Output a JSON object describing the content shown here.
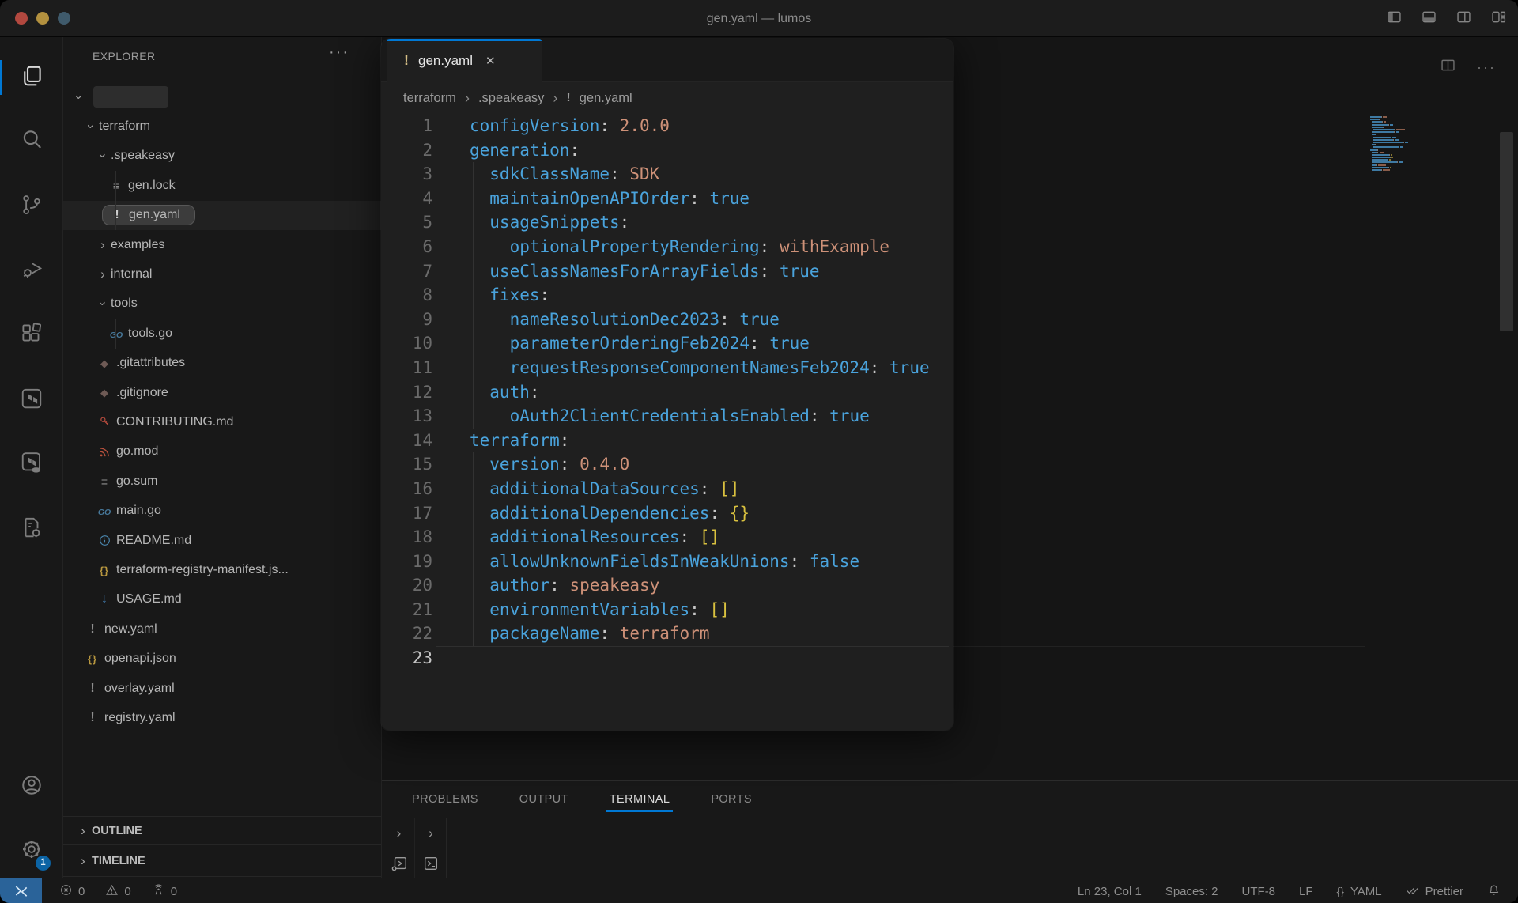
{
  "window": {
    "title": "gen.yaml — lumos"
  },
  "colors": {
    "accent": "#0078d4",
    "token_key": "#4aa3dc",
    "token_string": "#ce9178",
    "token_bracket": "#d9c13f",
    "token_punct": "#c8c8c8",
    "traffic_red": "#b2483f",
    "traffic_yellow": "#b3913f",
    "traffic_green_dim": "#3f5a6b",
    "remote_bg": "#2a6399"
  },
  "titlebar_icons": [
    "toggle-sidebar-icon",
    "toggle-panel-icon",
    "toggle-secondary-sidebar-icon",
    "customize-layout-icon"
  ],
  "activity_bar": {
    "items": [
      {
        "name": "explorer",
        "icon": "files-icon",
        "active": true
      },
      {
        "name": "search",
        "icon": "search-icon",
        "active": false
      },
      {
        "name": "source-control",
        "icon": "git-branch-icon",
        "active": false
      },
      {
        "name": "run-debug",
        "icon": "debug-icon",
        "active": false
      },
      {
        "name": "extensions",
        "icon": "extensions-icon",
        "active": false
      },
      {
        "name": "terraform",
        "icon": "terraform-icon",
        "active": false
      },
      {
        "name": "terraform-cloud",
        "icon": "terraform-cloud-icon",
        "active": false
      },
      {
        "name": "file-tools",
        "icon": "file-gear-icon",
        "active": false
      }
    ],
    "bottom": {
      "account": "account-icon",
      "settings": "gear-icon",
      "settings_badge": "1"
    }
  },
  "sidebar": {
    "header": "EXPLORER",
    "more_label": "···",
    "tree": [
      {
        "label": "",
        "level": 0,
        "kind": "workspace-redacted",
        "expanded": true
      },
      {
        "label": "terraform",
        "level": 1,
        "kind": "folder",
        "expanded": true
      },
      {
        "label": ".speakeasy",
        "level": 2,
        "kind": "folder",
        "expanded": true
      },
      {
        "label": "gen.lock",
        "level": 3,
        "kind": "file",
        "icon": "list"
      },
      {
        "label": "gen.yaml",
        "level": 3,
        "kind": "file",
        "icon": "warn-bright",
        "selected": true
      },
      {
        "label": "examples",
        "level": 2,
        "kind": "folder",
        "expanded": false
      },
      {
        "label": "internal",
        "level": 2,
        "kind": "folder",
        "expanded": false
      },
      {
        "label": "tools",
        "level": 2,
        "kind": "folder",
        "expanded": true
      },
      {
        "label": "tools.go",
        "level": 3,
        "kind": "file",
        "icon": "go"
      },
      {
        "label": ".gitattributes",
        "level": 2,
        "kind": "file",
        "icon": "git"
      },
      {
        "label": ".gitignore",
        "level": 2,
        "kind": "file",
        "icon": "git"
      },
      {
        "label": "CONTRIBUTING.md",
        "level": 2,
        "kind": "file",
        "icon": "key"
      },
      {
        "label": "go.mod",
        "level": 2,
        "kind": "file",
        "icon": "rss"
      },
      {
        "label": "go.sum",
        "level": 2,
        "kind": "file",
        "icon": "list"
      },
      {
        "label": "main.go",
        "level": 2,
        "kind": "file",
        "icon": "go"
      },
      {
        "label": "README.md",
        "level": 2,
        "kind": "file",
        "icon": "info"
      },
      {
        "label": "terraform-registry-manifest.js...",
        "level": 2,
        "kind": "file",
        "icon": "braces"
      },
      {
        "label": "USAGE.md",
        "level": 2,
        "kind": "file",
        "icon": "arrow-down"
      },
      {
        "label": "new.yaml",
        "level": 1,
        "kind": "file",
        "icon": "warn"
      },
      {
        "label": "openapi.json",
        "level": 1,
        "kind": "file",
        "icon": "braces"
      },
      {
        "label": "overlay.yaml",
        "level": 1,
        "kind": "file",
        "icon": "warn"
      },
      {
        "label": "registry.yaml",
        "level": 1,
        "kind": "file",
        "icon": "warn"
      }
    ],
    "sections": [
      {
        "label": "OUTLINE"
      },
      {
        "label": "TIMELINE"
      }
    ]
  },
  "editor": {
    "tab": {
      "label": "gen.yaml",
      "close_label": "✕",
      "warn_mark": "!"
    },
    "breadcrumb": [
      "terraform",
      ".speakeasy",
      "gen.yaml"
    ],
    "active_line": 23,
    "code_lines": [
      {
        "n": 1,
        "tokens": [
          [
            "key",
            "configVersion"
          ],
          [
            "punct",
            ":"
          ],
          [
            "str",
            " 2.0.0"
          ]
        ]
      },
      {
        "n": 2,
        "tokens": [
          [
            "key",
            "generation"
          ],
          [
            "punct",
            ":"
          ]
        ]
      },
      {
        "n": 3,
        "tokens": [
          [
            "key",
            "  sdkClassName"
          ],
          [
            "punct",
            ":"
          ],
          [
            "str",
            " SDK"
          ]
        ]
      },
      {
        "n": 4,
        "tokens": [
          [
            "key",
            "  maintainOpenAPIOrder"
          ],
          [
            "punct",
            ":"
          ],
          [
            "bool",
            " true"
          ]
        ]
      },
      {
        "n": 5,
        "tokens": [
          [
            "key",
            "  usageSnippets"
          ],
          [
            "punct",
            ":"
          ]
        ]
      },
      {
        "n": 6,
        "tokens": [
          [
            "key",
            "    optionalPropertyRendering"
          ],
          [
            "punct",
            ":"
          ],
          [
            "str",
            " withExample"
          ]
        ]
      },
      {
        "n": 7,
        "tokens": [
          [
            "key",
            "  useClassNamesForArrayFields"
          ],
          [
            "punct",
            ":"
          ],
          [
            "bool",
            " true"
          ]
        ]
      },
      {
        "n": 8,
        "tokens": [
          [
            "key",
            "  fixes"
          ],
          [
            "punct",
            ":"
          ]
        ]
      },
      {
        "n": 9,
        "tokens": [
          [
            "key",
            "    nameResolutionDec2023"
          ],
          [
            "punct",
            ":"
          ],
          [
            "bool",
            " true"
          ]
        ]
      },
      {
        "n": 10,
        "tokens": [
          [
            "key",
            "    parameterOrderingFeb2024"
          ],
          [
            "punct",
            ":"
          ],
          [
            "bool",
            " true"
          ]
        ]
      },
      {
        "n": 11,
        "tokens": [
          [
            "key",
            "    requestResponseComponentNamesFeb2024"
          ],
          [
            "punct",
            ":"
          ],
          [
            "bool",
            " true"
          ]
        ]
      },
      {
        "n": 12,
        "tokens": [
          [
            "key",
            "  auth"
          ],
          [
            "punct",
            ":"
          ]
        ]
      },
      {
        "n": 13,
        "tokens": [
          [
            "key",
            "    oAuth2ClientCredentialsEnabled"
          ],
          [
            "punct",
            ":"
          ],
          [
            "bool",
            " true"
          ]
        ]
      },
      {
        "n": 14,
        "tokens": [
          [
            "key",
            "terraform"
          ],
          [
            "punct",
            ":"
          ]
        ]
      },
      {
        "n": 15,
        "tokens": [
          [
            "key",
            "  version"
          ],
          [
            "punct",
            ":"
          ],
          [
            "str",
            " 0.4.0"
          ]
        ]
      },
      {
        "n": 16,
        "tokens": [
          [
            "key",
            "  additionalDataSources"
          ],
          [
            "punct",
            ":"
          ],
          [
            "bracket",
            " []"
          ]
        ]
      },
      {
        "n": 17,
        "tokens": [
          [
            "key",
            "  additionalDependencies"
          ],
          [
            "punct",
            ":"
          ],
          [
            "bracket",
            " {}"
          ]
        ]
      },
      {
        "n": 18,
        "tokens": [
          [
            "key",
            "  additionalResources"
          ],
          [
            "punct",
            ":"
          ],
          [
            "bracket",
            " []"
          ]
        ]
      },
      {
        "n": 19,
        "tokens": [
          [
            "key",
            "  allowUnknownFieldsInWeakUnions"
          ],
          [
            "punct",
            ":"
          ],
          [
            "bool",
            " false"
          ]
        ]
      },
      {
        "n": 20,
        "tokens": [
          [
            "key",
            "  author"
          ],
          [
            "punct",
            ":"
          ],
          [
            "str",
            " speakeasy"
          ]
        ]
      },
      {
        "n": 21,
        "tokens": [
          [
            "key",
            "  environmentVariables"
          ],
          [
            "punct",
            ":"
          ],
          [
            "bracket",
            " []"
          ]
        ]
      },
      {
        "n": 22,
        "tokens": [
          [
            "key",
            "  packageName"
          ],
          [
            "punct",
            ":"
          ],
          [
            "str",
            " terraform"
          ]
        ]
      },
      {
        "n": 23,
        "tokens": []
      }
    ]
  },
  "bottom_panel": {
    "tabs": [
      {
        "label": "PROBLEMS",
        "active": false
      },
      {
        "label": "OUTPUT",
        "active": false
      },
      {
        "label": "TERMINAL",
        "active": true
      },
      {
        "label": "PORTS",
        "active": false
      }
    ],
    "corner_icons": [
      "chevron-right-icon",
      "chevron-right-icon",
      "debug-console-icon",
      "terminal-icon"
    ]
  },
  "status_bar": {
    "left": [
      {
        "icon": "error-circle-icon",
        "text": "0"
      },
      {
        "icon": "warning-triangle-icon",
        "text": "0"
      },
      {
        "icon": "broadcast-tower-icon",
        "text": "0"
      }
    ],
    "right": [
      {
        "name": "cursor-position",
        "text": "Ln 23, Col 1"
      },
      {
        "name": "indentation",
        "text": "Spaces: 2"
      },
      {
        "name": "encoding",
        "text": "UTF-8"
      },
      {
        "name": "eol",
        "text": "LF"
      },
      {
        "name": "language-mode",
        "icon": "braces",
        "text": "YAML"
      },
      {
        "name": "formatter",
        "icon": "check-double-icon",
        "text": "Prettier"
      },
      {
        "name": "notifications",
        "icon": "bell-icon",
        "text": ""
      }
    ]
  }
}
